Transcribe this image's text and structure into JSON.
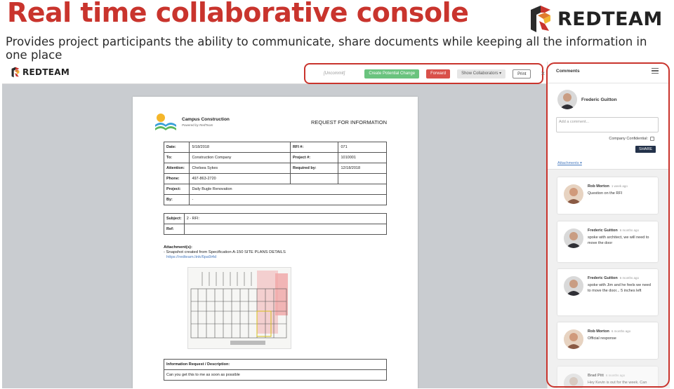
{
  "slide": {
    "title": "Real time collaborative console",
    "subtitle": "Provides project participants the ability to communicate, share documents while keeping all the information in one place",
    "brand": "REDTEAM"
  },
  "app": {
    "logo": "REDTEAM",
    "toolbar": {
      "uncommitted": "[Uncommit]",
      "create_label": "Create Potential Change",
      "forward_label": "Forward",
      "collaborators_label": "Show Collaborators ▾",
      "print_label": "Print",
      "close_label": "×"
    },
    "document": {
      "company_name": "Campus Construction",
      "company_tagline": "Powered by RedTeam",
      "heading": "REQUEST FOR INFORMATION",
      "fields": {
        "date_label": "Date:",
        "date": "5/18/2018",
        "rfi_label": "RFI #:",
        "rfi": "071",
        "to_label": "To:",
        "to": "Construction Company",
        "project_no_label": "Project #:",
        "project_no": "1010001",
        "attention_label": "Attention:",
        "attention": "Chelsea Sykes",
        "required_label": "Required by:",
        "required": "12/18/2018",
        "phone_label": "Phone:",
        "phone": "497-863-2720",
        "project_label": "Project:",
        "project": "Daily Bugle Renovation",
        "by_label": "By:",
        "by": "-",
        "subject_label": "Subject:",
        "subject": "2 - RFI:",
        "ref_label": "Ref:",
        "ref": ""
      },
      "attachments_title": "Attachment(s):",
      "attachment_line": "- Snapshot created from Specification A-150 SITE PLANS DETAILS",
      "attachment_link": "https://redteam.link/6pa9i4d",
      "description_label": "Information Request / Description:",
      "description": "Can you get this to me as soon as possible"
    },
    "comments": {
      "title": "Comments",
      "current_user": "Frederic Guitton",
      "input_placeholder": "Add a comment...",
      "confidential_label": "Company Confidential:",
      "share_label": "SHARE",
      "attachments_toggle": "Attachments ▾",
      "items": [
        {
          "author": "Rob Morton",
          "time": "1 week ago",
          "text": "Question on the RFI"
        },
        {
          "author": "Frederic Guitton",
          "time": "6 months ago",
          "text": "spoke with architect, we will need to move the door"
        },
        {
          "author": "Frederic Guitton",
          "time": "6 months ago",
          "text": "spoke with Jim and he feels we need to move the door... 5 inches left"
        },
        {
          "author": "Rob Morton",
          "time": "6 months ago",
          "text": "Official response"
        },
        {
          "author": "Brad Pitt",
          "time": "6 months ago",
          "text": "Hey Kevin is out for the week. Can"
        }
      ]
    }
  },
  "colors": {
    "accent_red": "#c9342d",
    "create_green": "#6ac37e",
    "forward_red": "#d9504a",
    "share_navy": "#23324a",
    "link_blue": "#4a7cc0"
  }
}
